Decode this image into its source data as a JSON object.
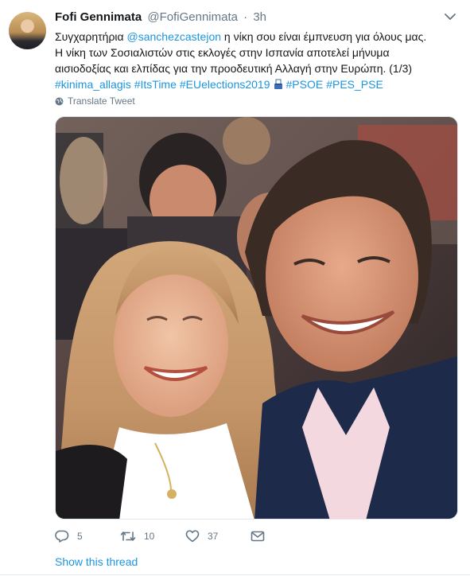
{
  "tweet": {
    "author": {
      "name": "Fofi Gennimata",
      "handle": "@FofiGennimata",
      "separator": "·",
      "time": "3h"
    },
    "text": {
      "line1_start": "Συγχαρητήρια ",
      "mention": "@sanchezcastejon",
      "line1_end": " η νίκη σου είναι έμπνευση για όλους μας.",
      "line2": "Η νίκη των Σοσιαλιστών στις εκλογές στην Ισπανία αποτελεί μήνυμα",
      "line3": "αισιοδοξίας και ελπίδας για την προοδευτική Αλλαγή στην Ευρώπη. (1/3)",
      "hashtags": [
        "#kinima_allagis",
        "#ItsTime",
        "#EUelections2019",
        "#PSOE",
        "#PES_PSE"
      ],
      "emoji_icon": "ballot-box-emoji"
    },
    "translate_label": "Translate Tweet",
    "actions": {
      "replies": "5",
      "retweets": "10",
      "likes": "37"
    },
    "show_thread_label": "Show this thread"
  },
  "colors": {
    "link": "#1b95e0",
    "secondary_text": "#657786",
    "primary_text": "#14171a",
    "border": "#e6ecf0"
  },
  "icons": {
    "caret": "chevron-down-icon",
    "translate": "globe-icon",
    "reply": "reply-icon",
    "retweet": "retweet-icon",
    "like": "heart-icon",
    "dm": "envelope-icon"
  }
}
